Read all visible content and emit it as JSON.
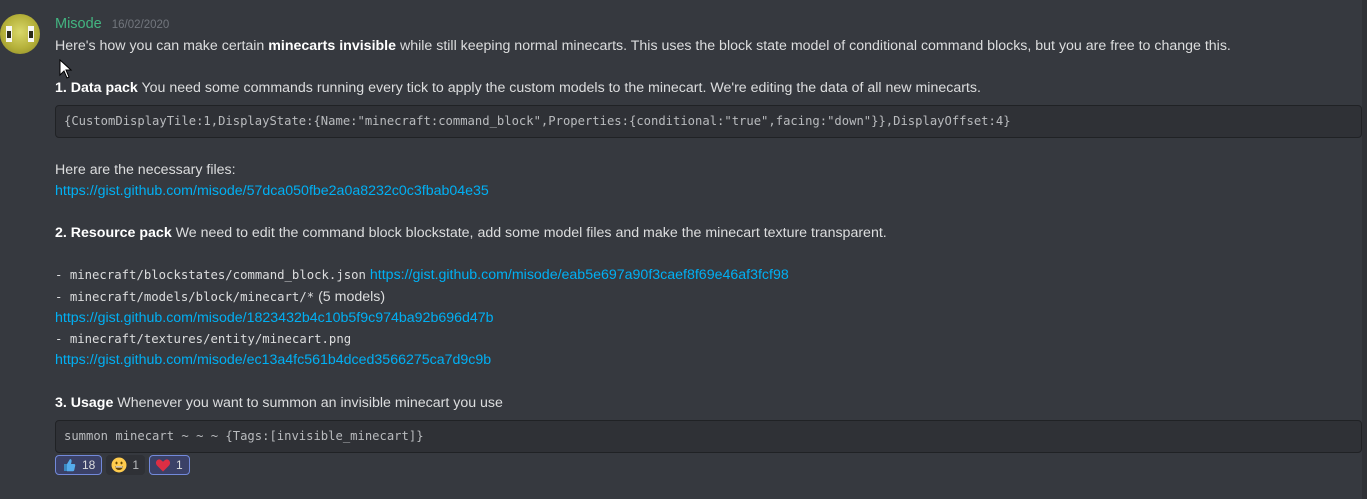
{
  "author": {
    "name": "Misode",
    "timestamp": "16/02/2020",
    "name_color": "#43b581"
  },
  "intro": {
    "before": "Here's how you can make certain ",
    "bold": "minecarts invisible",
    "after": " while still keeping normal minecarts. This uses the block state model of conditional command blocks, but you are free to change this."
  },
  "section1": {
    "heading": "1. Data pack",
    "text": " You need some commands running every tick to apply the custom models to the minecart. We're editing the data of all new minecarts.",
    "code": "{CustomDisplayTile:1,DisplayState:{Name:\"minecraft:command_block\",Properties:{conditional:\"true\",facing:\"down\"}},DisplayOffset:4}",
    "files_label": "Here are the necessary files:",
    "link": "https://gist.github.com/misode/57dca050fbe2a0a8232c0c3fbab04e35"
  },
  "section2": {
    "heading": "2. Resource pack",
    "text": " We need to edit the command block blockstate, add some model files and make the minecart texture transparent.",
    "items": [
      {
        "prefix": "- ",
        "path": "minecraft/blockstates/command_block.json",
        "note": " ",
        "link": "https://gist.github.com/misode/eab5e697a90f3caef8f69e46af3fcf98"
      },
      {
        "prefix": "- ",
        "path": "minecraft/models/block/minecart/*",
        "note": " (5 models)",
        "link": "https://gist.github.com/misode/1823432b4c10b5f9c974ba92b696d47b"
      },
      {
        "prefix": "- ",
        "path": "minecraft/textures/entity/minecart.png",
        "note": "",
        "link": "https://gist.github.com/misode/ec13a4fc561b4dced3566275ca7d9c9b"
      }
    ]
  },
  "section3": {
    "heading": "3. Usage",
    "text": " Whenever you want to summon an invisible minecart you use",
    "code": "summon minecart ~ ~ ~ {Tags:[invisible_minecart]}"
  },
  "reactions": [
    {
      "emoji": "thumbs-up-droplet",
      "count": "18",
      "active": true
    },
    {
      "emoji": "grinning-face",
      "count": "1",
      "active": false
    },
    {
      "emoji": "red-heart",
      "count": "1",
      "active": true
    }
  ],
  "colors": {
    "background": "#36393f",
    "link": "#00b0f4",
    "code_bg": "#2f3136"
  }
}
